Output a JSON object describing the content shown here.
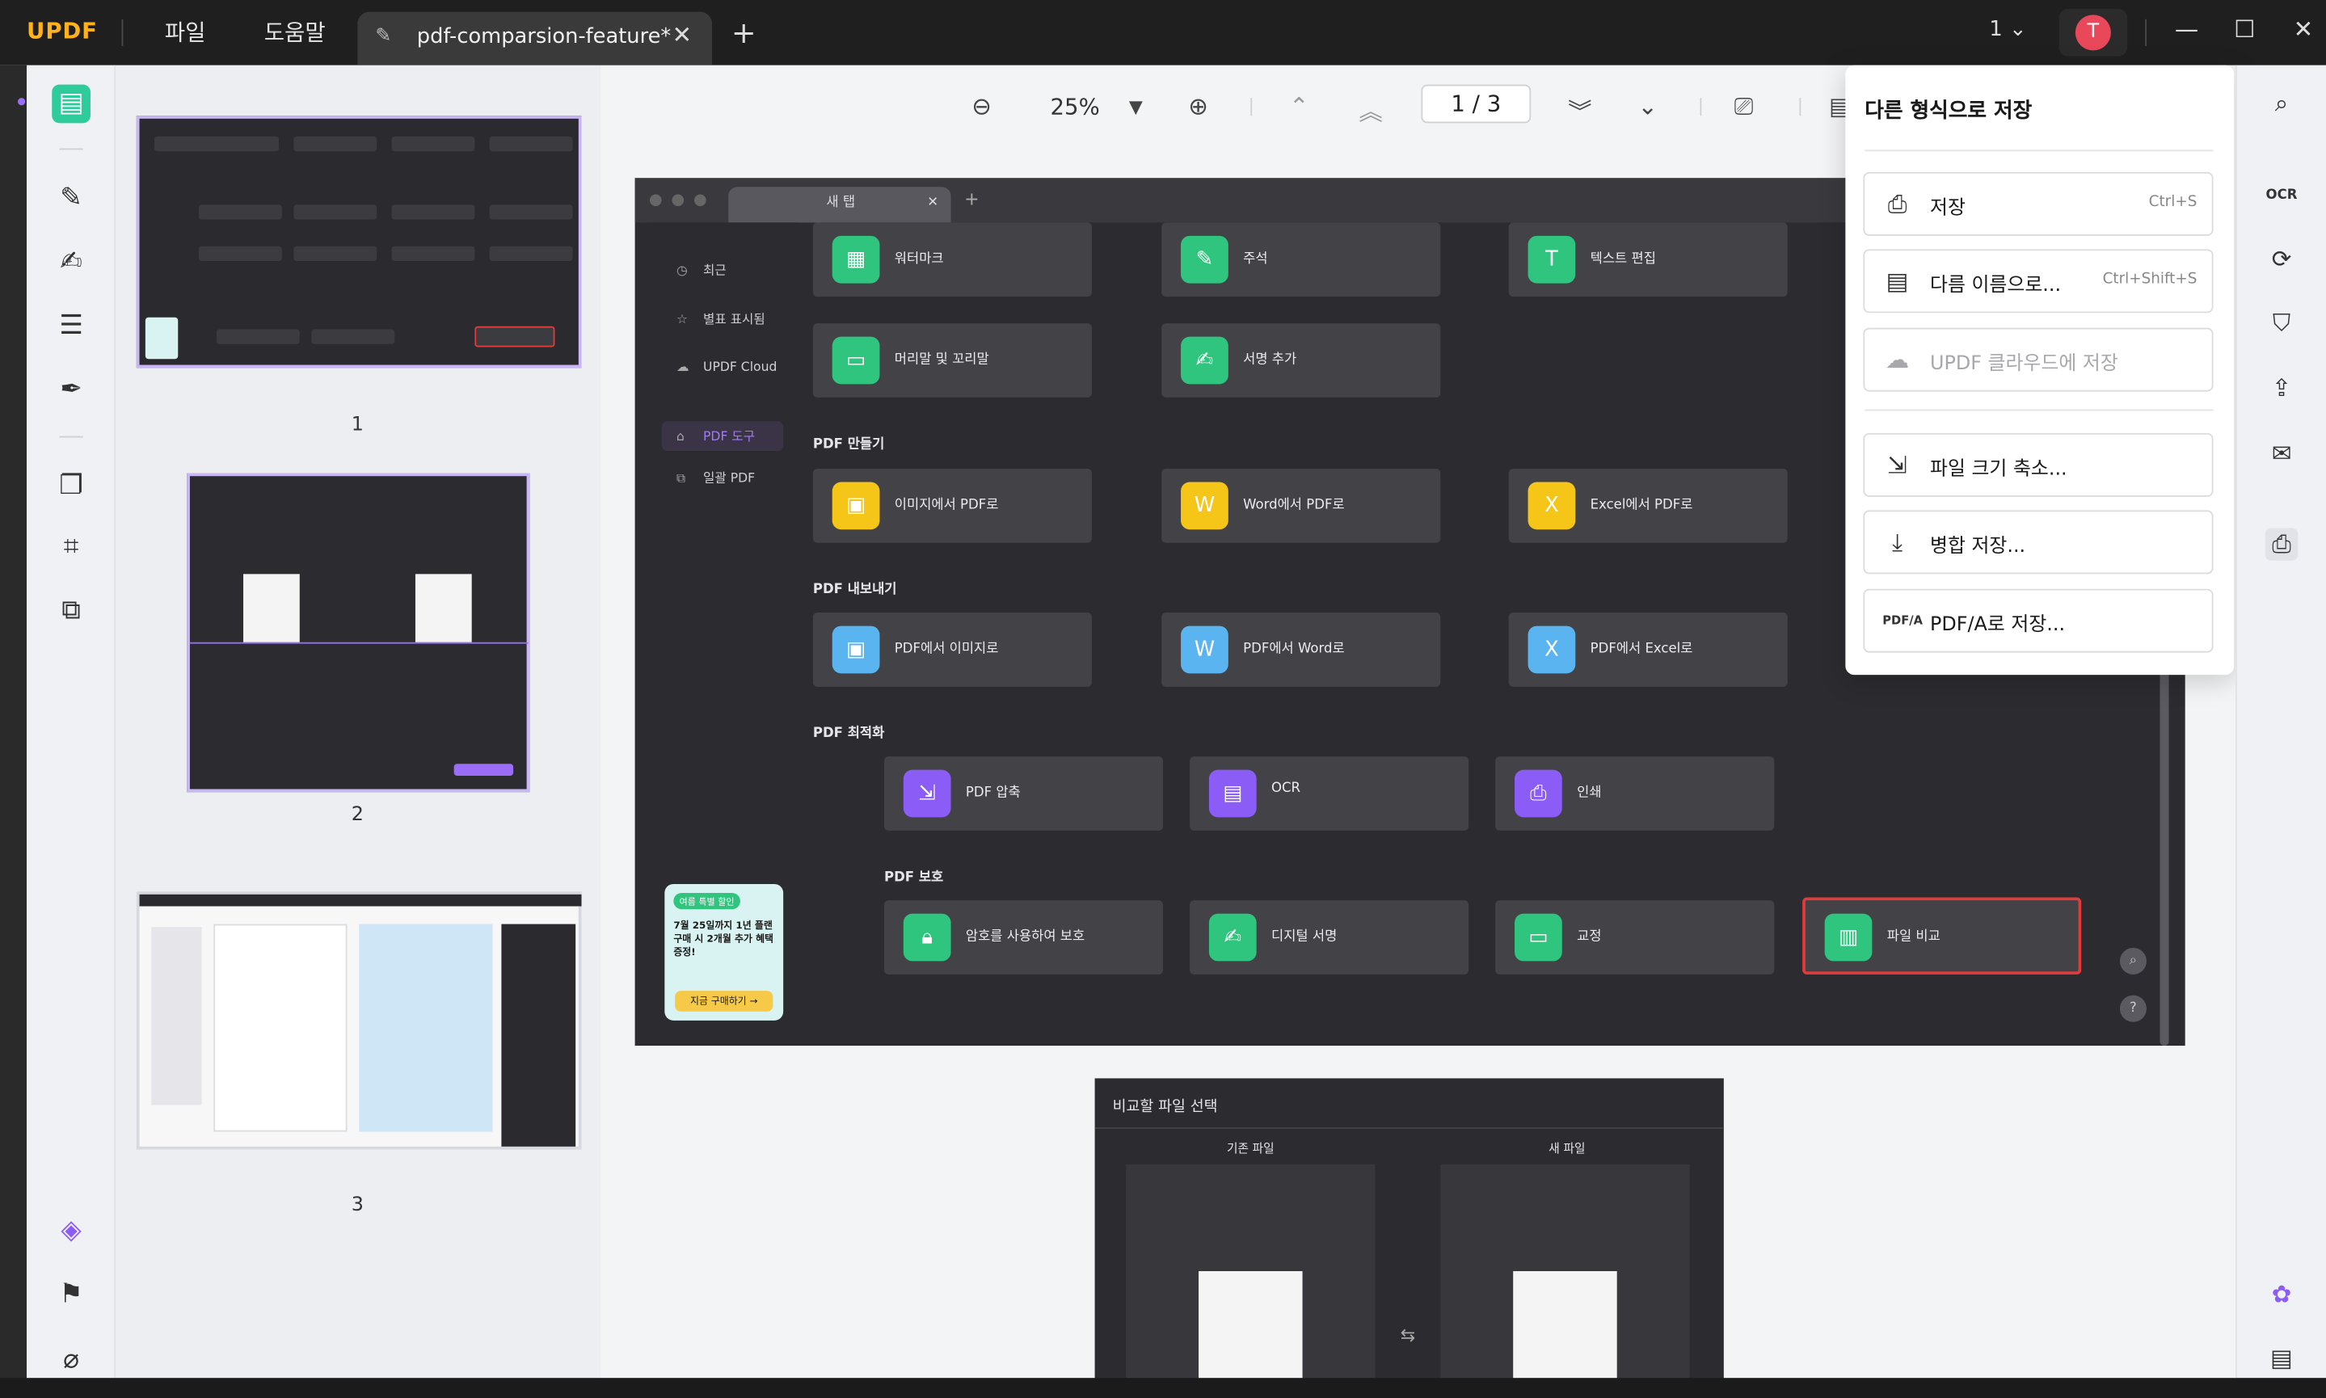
{
  "app": {
    "logo": "UPDF"
  },
  "menu": {
    "file": "파일",
    "help": "도움말"
  },
  "tab": {
    "title": "pdf-comparsion-feature*"
  },
  "titlebar": {
    "page_selector": "1",
    "avatar_letter": "T"
  },
  "toolbar": {
    "zoom": "25%",
    "page_current": "1",
    "page_sep": "/",
    "page_total": "3"
  },
  "thumbnails": {
    "labels": [
      "1",
      "2",
      "3"
    ]
  },
  "page1": {
    "tab_label": "새 탭",
    "sidebar": [
      {
        "label": "최근",
        "icon": "clock-icon"
      },
      {
        "label": "별표 표시됨",
        "icon": "star-icon"
      },
      {
        "label": "UPDF Cloud",
        "icon": "cloud-icon"
      },
      {
        "label": "PDF 도구",
        "icon": "toolbox-icon"
      },
      {
        "label": "일괄 PDF",
        "icon": "batch-icon"
      }
    ],
    "row_top": [
      "워터마크",
      "주석",
      "텍스트 편집"
    ],
    "row_second": [
      "머리말 및 꼬리말",
      "서명 추가"
    ],
    "section_create": "PDF 만들기",
    "create": [
      "이미지에서 PDF로",
      "Word에서 PDF로",
      "Excel에서 PDF로"
    ],
    "section_export": "PDF 내보내기",
    "export": [
      "PDF에서 이미지로",
      "PDF에서 Word로",
      "PDF에서 Excel로"
    ],
    "section_optimize": "PDF 최적화",
    "optimize": [
      "PDF 압축",
      "OCR",
      "인쇄"
    ],
    "section_protect": "PDF 보호",
    "protect": [
      "암호를 사용하여 보호",
      "디지털 서명",
      "교정",
      "파일 비교"
    ],
    "promo": {
      "badge": "여름 특별 할인",
      "text": "7월 25일까지 1년 플랜 구매 시 2개월 추가 혜택 증정!",
      "button": "지금 구매하기 →"
    }
  },
  "page2": {
    "title": "비교할 파일 선택",
    "old_file": "기존 파일",
    "new_file": "새 파일"
  },
  "save_menu": {
    "title": "다른 형식으로 저장",
    "items": [
      {
        "label": "저장",
        "shortcut": "Ctrl+S",
        "icon": "save-icon",
        "enabled": true
      },
      {
        "label": "다름 이름으로...",
        "shortcut": "Ctrl+Shift+S",
        "icon": "save-as-icon",
        "enabled": true
      },
      {
        "label": "UPDF 클라우드에 저장",
        "shortcut": "",
        "icon": "cloud-upload-icon",
        "enabled": false
      },
      {
        "label": "파일 크기 축소...",
        "shortcut": "",
        "icon": "compress-icon",
        "enabled": true
      },
      {
        "label": "병합 저장...",
        "shortcut": "",
        "icon": "flatten-save-icon",
        "enabled": true
      },
      {
        "label": "PDF/A로 저장...",
        "shortcut": "",
        "icon": "pdfa-icon",
        "enabled": true
      }
    ]
  },
  "colors": {
    "accent": "#8b5cf6",
    "green": "#2fc57e",
    "highlight": "#e03c3c"
  }
}
